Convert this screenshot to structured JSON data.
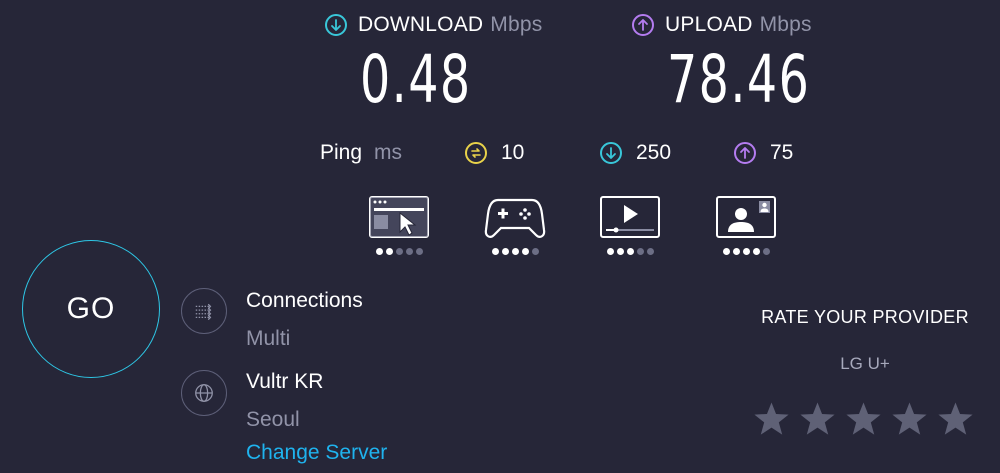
{
  "download": {
    "label": "DOWNLOAD",
    "unit": "Mbps",
    "value": "0.48",
    "icon": "arrow-down-circle-icon",
    "color": "#39c7d9"
  },
  "upload": {
    "label": "UPLOAD",
    "unit": "Mbps",
    "value": "78.46",
    "icon": "arrow-up-circle-icon",
    "color": "#b47cf0"
  },
  "ping": {
    "label": "Ping",
    "unit": "ms",
    "idle": {
      "value": "10",
      "icon": "ping-idle-icon",
      "color": "#e8d24a"
    },
    "download": {
      "value": "250",
      "icon": "arrow-down-circle-icon",
      "color": "#39c7d9"
    },
    "upload": {
      "value": "75",
      "icon": "arrow-up-circle-icon",
      "color": "#b47cf0"
    }
  },
  "quality": [
    {
      "name": "web-browsing",
      "icon": "browser-cursor-icon",
      "rating": 2,
      "max": 5
    },
    {
      "name": "gaming",
      "icon": "gamepad-icon",
      "rating": 4,
      "max": 5
    },
    {
      "name": "streaming",
      "icon": "video-player-icon",
      "rating": 3,
      "max": 5
    },
    {
      "name": "video-chat",
      "icon": "video-call-icon",
      "rating": 4,
      "max": 5
    }
  ],
  "go": {
    "label": "GO",
    "accent": "#2ec7e6"
  },
  "connections": {
    "title": "Connections",
    "value": "Multi",
    "icon": "connections-icon"
  },
  "server": {
    "name": "Vultr KR",
    "location": "Seoul",
    "change_label": "Change Server",
    "icon": "globe-icon"
  },
  "rate": {
    "title": "RATE YOUR PROVIDER",
    "provider": "LG U+",
    "stars": 5,
    "rating": 0
  }
}
